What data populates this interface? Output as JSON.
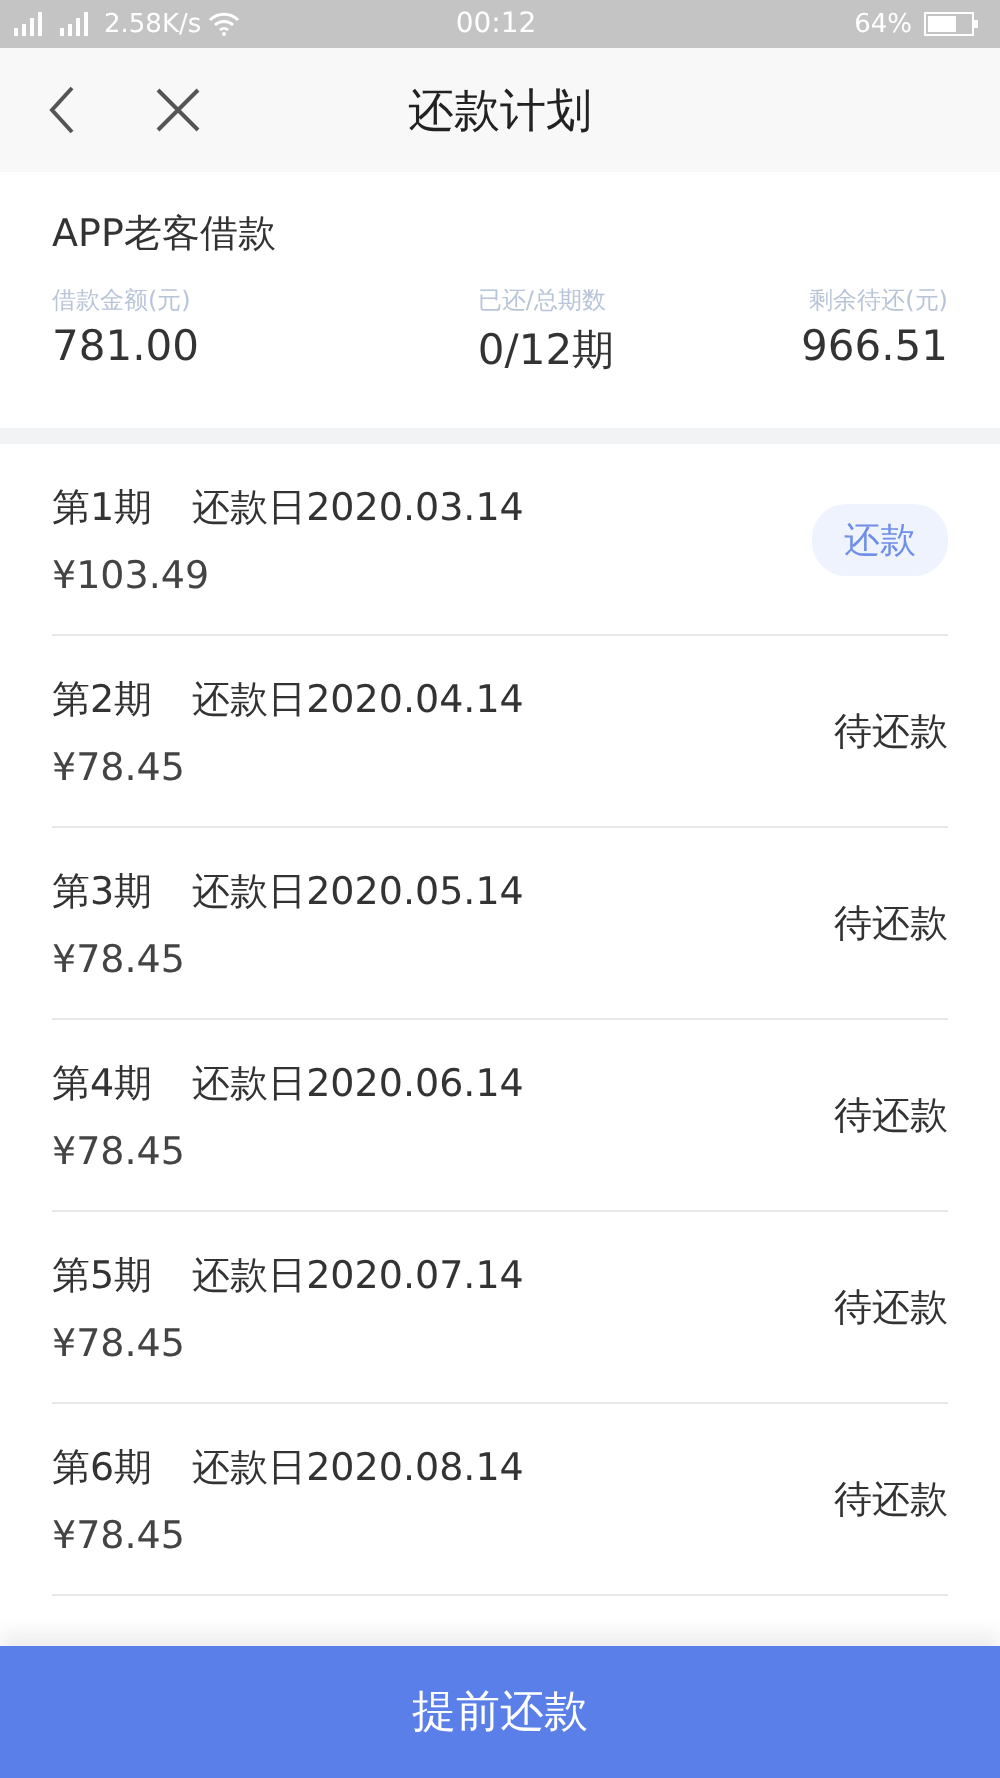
{
  "status_bar": {
    "network": "2.58K/s",
    "time": "00:12",
    "battery": "64%"
  },
  "nav": {
    "title": "还款计划"
  },
  "summary": {
    "name": "APP老客借款",
    "stats": [
      {
        "label": "借款金额(元)",
        "value": "781.00"
      },
      {
        "label": "已还/总期数",
        "value": "0/12期"
      },
      {
        "label": "剩余待还(元)",
        "value": "966.51"
      }
    ]
  },
  "installments": [
    {
      "period": "第1期",
      "due": "还款日2020.03.14",
      "amount": "¥103.49",
      "status": "还款",
      "kind": "button"
    },
    {
      "period": "第2期",
      "due": "还款日2020.04.14",
      "amount": "¥78.45",
      "status": "待还款",
      "kind": "label"
    },
    {
      "period": "第3期",
      "due": "还款日2020.05.14",
      "amount": "¥78.45",
      "status": "待还款",
      "kind": "label"
    },
    {
      "period": "第4期",
      "due": "还款日2020.06.14",
      "amount": "¥78.45",
      "status": "待还款",
      "kind": "label"
    },
    {
      "period": "第5期",
      "due": "还款日2020.07.14",
      "amount": "¥78.45",
      "status": "待还款",
      "kind": "label"
    },
    {
      "period": "第6期",
      "due": "还款日2020.08.14",
      "amount": "¥78.45",
      "status": "待还款",
      "kind": "label"
    }
  ],
  "footer_button": "提前还款"
}
